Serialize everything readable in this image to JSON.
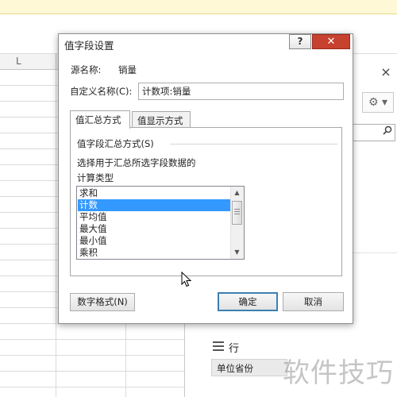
{
  "spreadsheet": {
    "column_letter": "L"
  },
  "task_pane": {
    "close_symbol": "×",
    "gear_icon": "gear-icon",
    "search_icon": "search-icon",
    "rows_label": "行",
    "row_field": "单位省份"
  },
  "watermark": "软件技巧",
  "dialog": {
    "title": "值字段设置",
    "help_symbol": "?",
    "close_symbol": "✕",
    "source_label": "源名称:",
    "source_value": "销量",
    "custom_name_label": "自定义名称(C):",
    "custom_name_value": "计数项:销量",
    "tabs": [
      {
        "label": "值汇总方式",
        "active": true
      },
      {
        "label": "值显示方式",
        "active": false
      }
    ],
    "summarize_label": "值字段汇总方式(S)",
    "description_line1": "选择用于汇总所选字段数据的",
    "description_line2": "计算类型",
    "list_items": [
      {
        "label": "求和",
        "selected": false
      },
      {
        "label": "计数",
        "selected": true
      },
      {
        "label": "平均值",
        "selected": false
      },
      {
        "label": "最大值",
        "selected": false
      },
      {
        "label": "最小值",
        "selected": false
      },
      {
        "label": "乘积",
        "selected": false
      }
    ],
    "scroll_up": "▲",
    "scroll_down": "▼",
    "number_format_button": "数字格式(N)",
    "ok_button": "确定",
    "cancel_button": "取消"
  },
  "colors": {
    "selection": "#3399ff",
    "close_button": "#c7412f",
    "default_button_border": "#3c7fb1"
  }
}
